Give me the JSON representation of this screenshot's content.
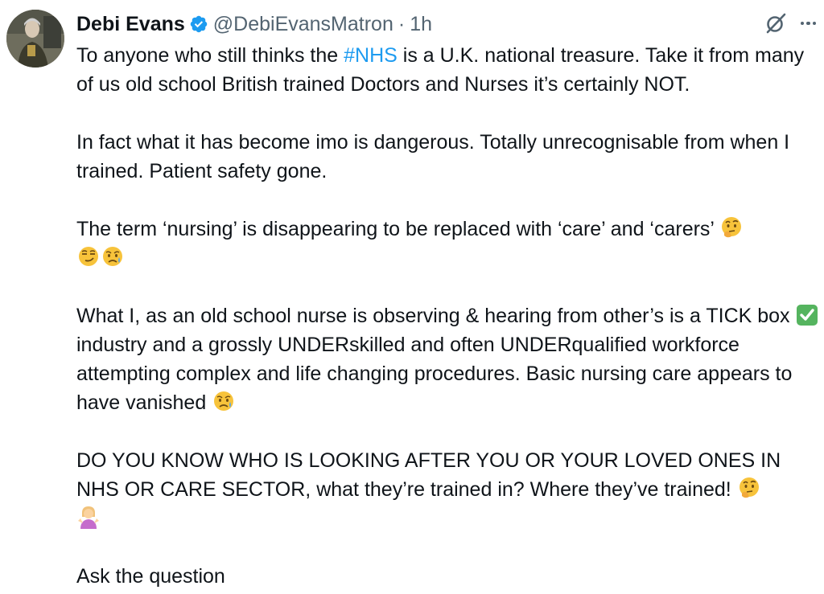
{
  "author": {
    "display_name": "Debi Evans",
    "handle": "@DebiEvansMatron",
    "separator": "·",
    "time": "1h"
  },
  "tweet": {
    "p1_before": "To anyone who still thinks the ",
    "p1_hashtag": "#NHS",
    "p1_after": " is a U.K. national treasure. Take it from many of us old school British trained Doctors and Nurses it’s certainly NOT.",
    "p2": "In fact what it has become imo is dangerous. Totally unrecognisable from when I trained. Patient safety gone.",
    "p3": "The term ‘nursing’ is disappearing to be replaced with ‘care’ and ‘carers’",
    "p4_before": "What I, as an old school nurse is observing & hearing from other’s is a TICK box",
    "p4_after": "industry and a grossly UNDERskilled and often UNDERqualified workforce attempting complex and life changing procedures. Basic nursing care appears to have vanished",
    "p5": "DO YOU KNOW WHO IS LOOKING AFTER YOU OR YOUR LOVED ONES IN NHS OR CARE SECTOR, what they’re trained in? Where they’ve trained!",
    "p6": "Ask the question"
  },
  "icons": {
    "verified": "verified-badge-icon",
    "grok": "grok-icon",
    "more": "more-icon",
    "thinking": "thinking-face-emoji",
    "smirk": "smirking-face-emoji",
    "sad": "sad-but-relieved-face-emoji",
    "check": "check-mark-button-emoji",
    "shrug": "person-shrugging-emoji"
  },
  "colors": {
    "text": "#0f1419",
    "secondary": "#536471",
    "link": "#1d9bf0",
    "verified": "#1d9bf0"
  }
}
